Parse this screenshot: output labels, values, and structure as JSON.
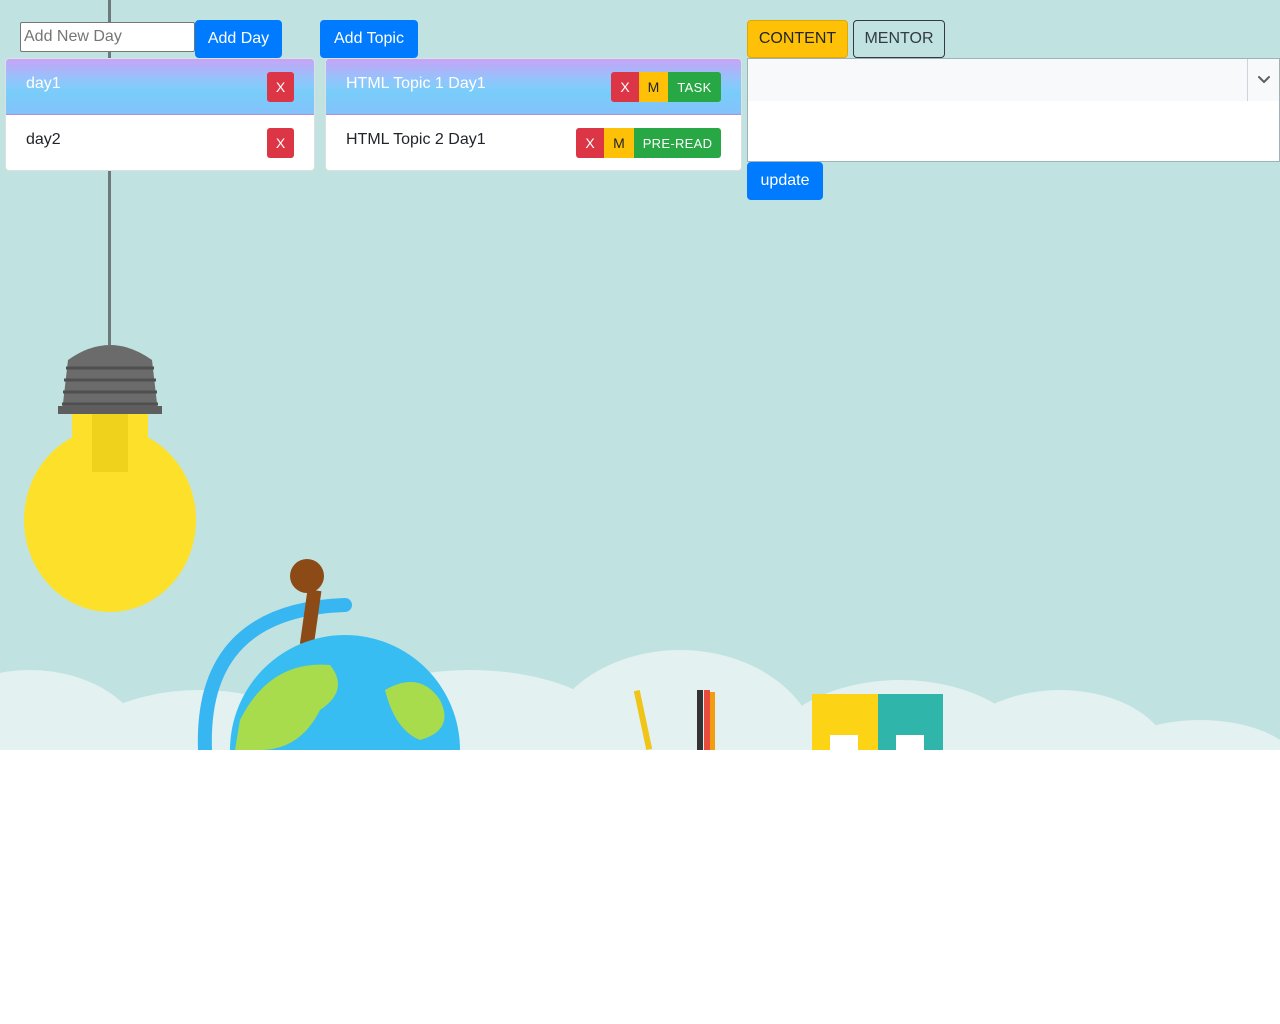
{
  "days": {
    "input_placeholder": "Add New Day",
    "add_button": "Add Day",
    "items": [
      {
        "label": "day1",
        "delete": "X",
        "active": true
      },
      {
        "label": "day2",
        "delete": "X",
        "active": false
      }
    ]
  },
  "topics": {
    "add_button": "Add Topic",
    "items": [
      {
        "label": "HTML Topic 1 Day1",
        "delete": "X",
        "mentor": "M",
        "tag": "TASK",
        "active": true
      },
      {
        "label": "HTML Topic 2 Day1",
        "delete": "X",
        "mentor": "M",
        "tag": "PRE-READ",
        "active": false
      }
    ]
  },
  "panel": {
    "tabs": [
      {
        "label": "CONTENT",
        "selected": true
      },
      {
        "label": "MENTOR",
        "selected": false
      }
    ],
    "editor_value": "",
    "update_button": "update",
    "dropdown_icon": "chevron-down-icon"
  },
  "colors": {
    "primary": "#007bff",
    "danger": "#dc3545",
    "warning": "#ffc107",
    "success": "#28a745",
    "background": "#c0e3e2"
  }
}
